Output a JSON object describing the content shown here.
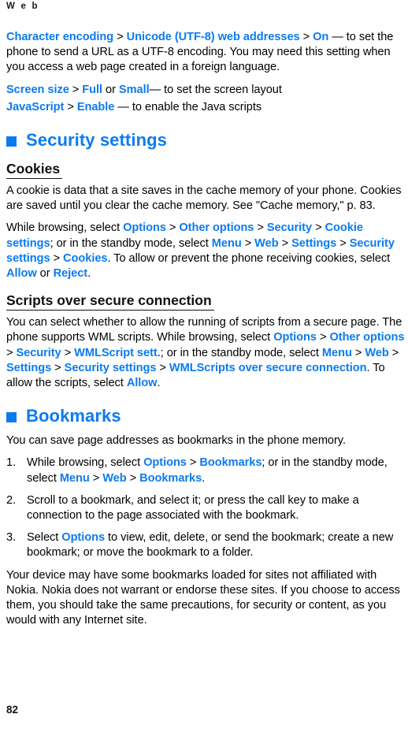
{
  "header": {
    "running_title": "W e b"
  },
  "colors": {
    "link_blue": "#0b7bf0",
    "heading_blue": "#0b7bf0",
    "body_text": "#000000"
  },
  "body": {
    "para_character_encoding": {
      "link1": "Character encoding",
      "sep1": " > ",
      "link2": "Unicode (UTF-8) web addresses",
      "sep2": " > ",
      "link3": "On",
      "tail": " — to set the phone to send a URL as a UTF-8 encoding. You may need this setting when you access a web page created in a foreign language."
    },
    "para_screen_size": {
      "link1": "Screen size",
      "sep1": " > ",
      "link2": "Full",
      "mid": " or ",
      "link3": "Small",
      "tail": "— to set the screen layout"
    },
    "para_javascript": {
      "link1": "JavaScript",
      "sep1": " > ",
      "link2": "Enable",
      "tail": " — to enable the Java scripts"
    }
  },
  "section_security": {
    "heading": "Security settings",
    "bullet_icon": "filled-square-icon",
    "cookies": {
      "heading": "Cookies",
      "para1": "A cookie is data that a site saves in the cache memory of your phone. Cookies are saved until you clear the cache memory. See \"Cache memory,\" p. 83.",
      "para2": {
        "lead": "While browsing, select ",
        "link1": "Options",
        "sep1": " > ",
        "link2": "Other options",
        "sep2": " > ",
        "link3": "Security",
        "sep3": " > ",
        "link4": "Cookie settings",
        "mid1": "; or in the standby mode, select ",
        "link5": "Menu",
        "sep4": " > ",
        "link6": "Web",
        "sep5": " > ",
        "link7": "Settings",
        "sep6": " > ",
        "link8": "Security settings",
        "sep7": " > ",
        "link9": "Cookies",
        "mid2": ". To allow or prevent the phone receiving cookies, select ",
        "link10": "Allow",
        "mid3": " or ",
        "link11": "Reject",
        "tail": "."
      }
    },
    "scripts": {
      "heading": "Scripts over secure connection",
      "para1": {
        "lead": "You can select whether to allow the running of scripts from a secure page. The phone supports WML scripts. While browsing, select ",
        "link1": "Options",
        "sep1": " > ",
        "link2": "Other options",
        "sep2": " > ",
        "link3": "Security",
        "sep3": " > ",
        "link4": "WMLScript sett.",
        "mid1": "; or in the standby mode, select ",
        "link5": "Menu",
        "sep4": " > ",
        "link6": "Web",
        "sep5": " > ",
        "link7": "Settings",
        "sep6": " > ",
        "link8": "Security settings",
        "sep7": " > ",
        "link9": "WMLScripts over secure connection",
        "mid2": ". To allow the scripts, select ",
        "link10": "Allow",
        "tail": "."
      }
    }
  },
  "section_bookmarks": {
    "heading": "Bookmarks",
    "bullet_icon": "filled-square-icon",
    "intro": "You can save page addresses as bookmarks in the phone memory.",
    "steps": [
      {
        "num": "1.",
        "lead": "While browsing, select ",
        "link1": "Options",
        "sep1": " > ",
        "link2": "Bookmarks",
        "mid1": "; or in the standby mode, select ",
        "link3": "Menu",
        "sep2": " > ",
        "link4": "Web",
        "sep3": " > ",
        "link5": "Bookmarks",
        "tail": "."
      },
      {
        "num": "2.",
        "lead": "Scroll to a bookmark, and select it; or press the call key to make a connection to the page associated with the bookmark.",
        "link1": "",
        "tail": ""
      },
      {
        "num": "3.",
        "lead": "Select ",
        "link1": "Options",
        "tail": " to view, edit, delete, or send the bookmark; create a new bookmark; or move the bookmark to a folder."
      }
    ],
    "disclaimer": "Your device may have some bookmarks loaded for sites not affiliated with Nokia. Nokia does not warrant or endorse these sites. If you choose to access them, you should take the same precautions, for security or content, as you would with any Internet site."
  },
  "footer": {
    "page_number": "82"
  }
}
